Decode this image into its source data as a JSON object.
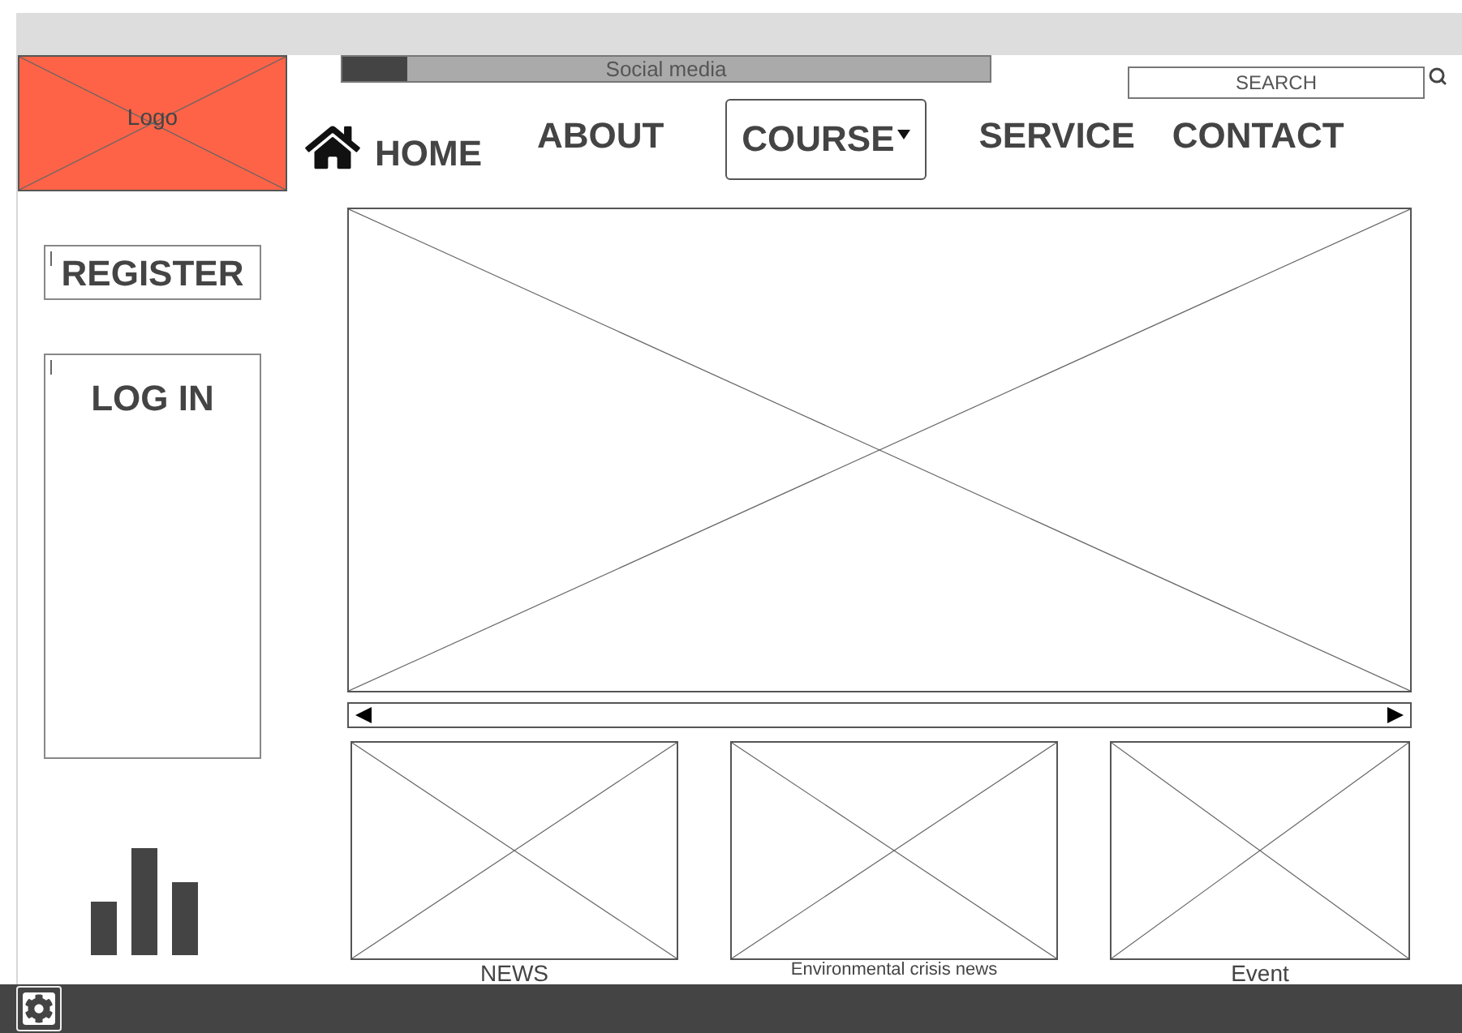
{
  "logo": {
    "label": "Logo"
  },
  "social_bar": {
    "label": "Social media",
    "level": 0.1
  },
  "search": {
    "placeholder": "SEARCH"
  },
  "nav": [
    {
      "label": "HOME",
      "kind": "home"
    },
    {
      "label": "ABOUT",
      "kind": "link"
    },
    {
      "label": "COURSE",
      "kind": "dropdown"
    },
    {
      "label": "SERVICE",
      "kind": "link"
    },
    {
      "label": "CONTACT",
      "kind": "link"
    }
  ],
  "sidebar": {
    "register": "REGISTER",
    "login": "LOG IN"
  },
  "cards": [
    {
      "caption": "NEWS"
    },
    {
      "caption": "Environmental crisis news"
    },
    {
      "caption": "Event"
    }
  ]
}
